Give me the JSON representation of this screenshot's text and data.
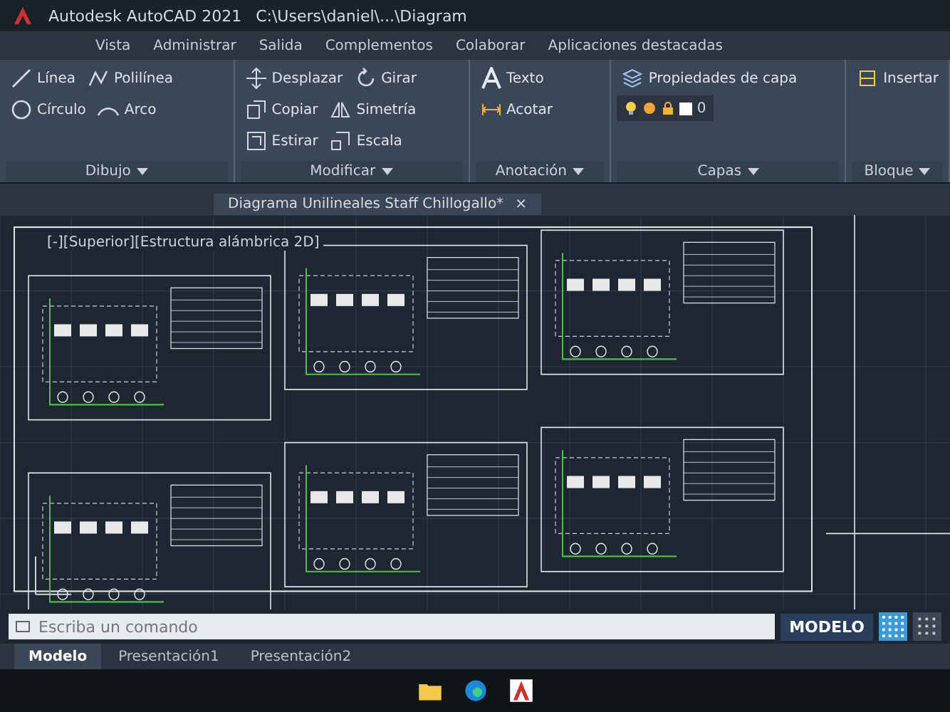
{
  "window": {
    "title": "Autodesk AutoCAD 2021",
    "path": "C:\\Users\\daniel\\...\\Diagram"
  },
  "ribbon_tabs": [
    {
      "label": "Vista",
      "selected": false
    },
    {
      "label": "Administrar",
      "selected": false
    },
    {
      "label": "Salida",
      "selected": false
    },
    {
      "label": "Complementos",
      "selected": false
    },
    {
      "label": "Colaborar",
      "selected": false
    },
    {
      "label": "Aplicaciones destacadas",
      "selected": false
    }
  ],
  "panels": [
    {
      "title": "Dibujo",
      "tools": [
        {
          "label": "Línea"
        },
        {
          "label": "Polilínea"
        },
        {
          "label": "Círculo"
        },
        {
          "label": "Arco"
        }
      ]
    },
    {
      "title": "Modificar",
      "tools": [
        {
          "label": "Desplazar"
        },
        {
          "label": "Girar"
        },
        {
          "label": "Copiar"
        },
        {
          "label": "Simetría"
        },
        {
          "label": "Estirar"
        },
        {
          "label": "Escala"
        }
      ]
    },
    {
      "title": "Anotación",
      "tools": [
        {
          "label": "Texto"
        },
        {
          "label": "Acotar"
        }
      ]
    },
    {
      "title": "Capas",
      "tools": [
        {
          "label": "Propiedades de capa"
        }
      ],
      "current_layer": "0"
    },
    {
      "title": "Bloque",
      "tools": [
        {
          "label": "Insertar"
        }
      ]
    }
  ],
  "file_tab": {
    "label": "Diagrama Unilineales Staff Chillogallo*",
    "close": "×"
  },
  "viewport_label": "[-][Superior][Estructura alámbrica 2D]",
  "command_line": {
    "placeholder": "Escriba un comando"
  },
  "layout_tabs": [
    {
      "label": "Modelo",
      "selected": true
    },
    {
      "label": "Presentación1",
      "selected": false
    },
    {
      "label": "Presentación2",
      "selected": false
    }
  ],
  "status_bar": {
    "space": "MODELO",
    "grid_on": true
  }
}
